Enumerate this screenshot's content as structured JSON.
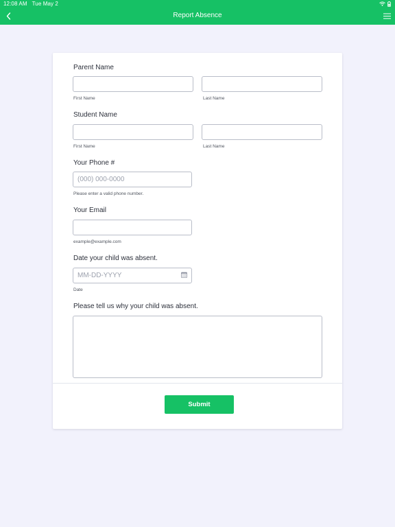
{
  "status_bar": {
    "time": "12:08 AM",
    "date": "Tue May 2"
  },
  "nav": {
    "title": "Report Absence",
    "back_icon": "chevron-left-icon",
    "menu_icon": "hamburger-menu-icon"
  },
  "colors": {
    "brand": "#16c165",
    "background": "#f2f2fc",
    "card": "#ffffff"
  },
  "form": {
    "parent_name": {
      "label": "Parent Name",
      "first": {
        "value": "",
        "sub_label": "First Name"
      },
      "last": {
        "value": "",
        "sub_label": "Last Name"
      }
    },
    "student_name": {
      "label": "Student Name",
      "first": {
        "value": "",
        "sub_label": "First Name"
      },
      "last": {
        "value": "",
        "sub_label": "Last Name"
      }
    },
    "phone": {
      "label": "Your Phone #",
      "value": "",
      "placeholder": "(000) 000-0000",
      "sub_label": "Please enter a valid phone number."
    },
    "email": {
      "label": "Your Email",
      "value": "",
      "sub_label": "example@example.com"
    },
    "absence_date": {
      "label": "Date your child was absent.",
      "value": "",
      "placeholder": "MM-DD-YYYY",
      "sub_label": "Date",
      "icon": "calendar-icon"
    },
    "reason": {
      "label": "Please tell us why your child was absent.",
      "value": ""
    },
    "submit_label": "Submit"
  }
}
